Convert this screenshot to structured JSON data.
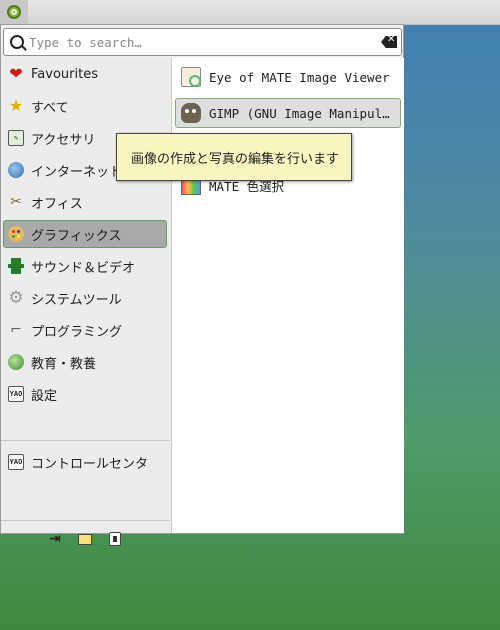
{
  "search": {
    "placeholder": "Type to search…",
    "value": ""
  },
  "categories": [
    {
      "label": "Favourites",
      "icon": "heart-icon"
    },
    {
      "label": "すべて",
      "icon": "star-icon"
    },
    {
      "label": "アクセサリ",
      "icon": "accessories-icon"
    },
    {
      "label": "インターネット",
      "icon": "globe-icon"
    },
    {
      "label": "オフィス",
      "icon": "office-icon"
    },
    {
      "label": "グラフィックス",
      "icon": "palette-icon",
      "selected": true
    },
    {
      "label": "サウンド＆ビデオ",
      "icon": "film-icon"
    },
    {
      "label": "システムツール",
      "icon": "gear-icon"
    },
    {
      "label": "プログラミング",
      "icon": "programming-icon"
    },
    {
      "label": "教育・教養",
      "icon": "education-icon"
    },
    {
      "label": "設定",
      "icon": "settings-icon"
    },
    {
      "label": "コントロールセンタ",
      "icon": "control-center-icon"
    }
  ],
  "apps": [
    {
      "label": "Eye of MATE Image Viewer",
      "icon": "image-viewer-icon"
    },
    {
      "label": "GIMP (GNU Image Manipul…",
      "icon": "gimp-icon"
    },
    {
      "label": "MATE 色選択",
      "icon": "color-select-icon"
    }
  ],
  "tooltip": {
    "text": "画像の作成と写真の編集を行います"
  },
  "session_actions": [
    "logout-icon",
    "lock-screen-icon",
    "shutdown-icon"
  ],
  "colors": {
    "selection_border": "#5aa55a",
    "tooltip_bg": "#f8f5c0",
    "desktop_top": "#3f7fb3",
    "desktop_bottom": "#3e8a3c"
  }
}
